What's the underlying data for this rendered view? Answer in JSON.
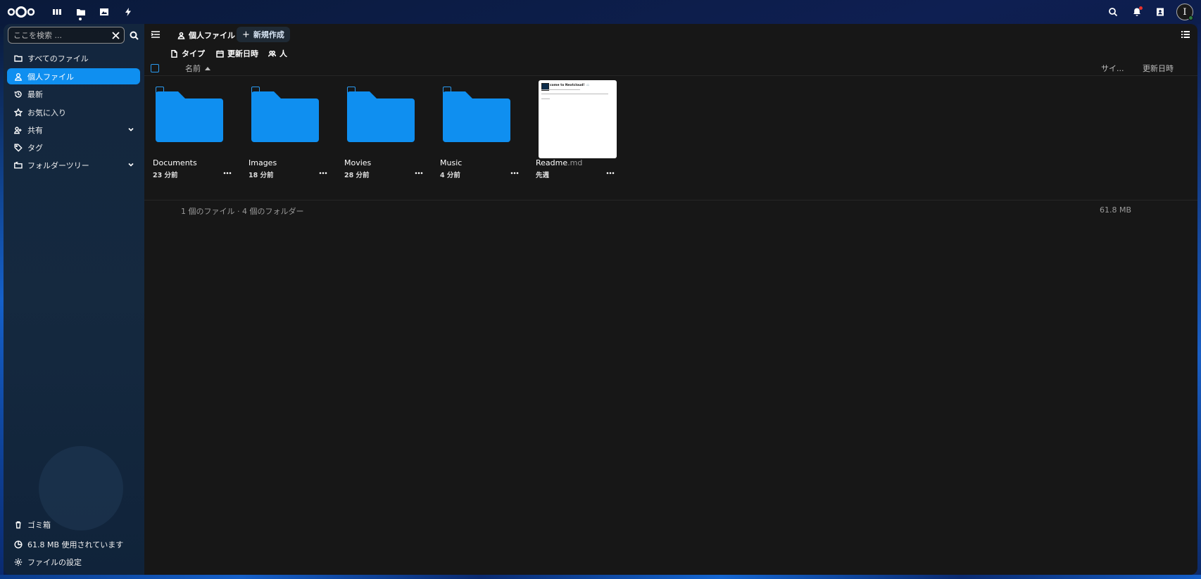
{
  "topbar": {
    "apps": [
      {
        "name": "dashboard",
        "icon": "dashboard-icon"
      },
      {
        "name": "files",
        "icon": "folder-icon",
        "active": true
      },
      {
        "name": "photos",
        "icon": "image-icon"
      },
      {
        "name": "activity",
        "icon": "lightning-icon"
      }
    ],
    "avatar_initial": "I"
  },
  "sidebar": {
    "search_placeholder": "ここを検索 ...",
    "items": [
      {
        "label": "すべてのファイル",
        "icon": "folder-icon"
      },
      {
        "label": "個人ファイル",
        "icon": "user-icon",
        "active": true
      },
      {
        "label": "最新",
        "icon": "history-icon"
      },
      {
        "label": "お気に入り",
        "icon": "star-icon"
      },
      {
        "label": "共有",
        "icon": "share-icon",
        "expandable": true
      },
      {
        "label": "タグ",
        "icon": "tag-icon"
      },
      {
        "label": "フォルダーツリー",
        "icon": "folder-tree-icon",
        "expandable": true
      }
    ],
    "footer": {
      "trash": "ゴミ箱",
      "quota": "61.8 MB 使用されています",
      "settings": "ファイルの設定"
    }
  },
  "main": {
    "breadcrumb": "個人ファイル",
    "new_button": "新規作成",
    "filters": {
      "type": "タイプ",
      "modified": "更新日時",
      "people": "人"
    },
    "columns": {
      "name": "名前",
      "size": "サイ...",
      "modified": "更新日時"
    },
    "files": [
      {
        "name": "Documents",
        "ext": "",
        "time": "23 分前",
        "kind": "folder"
      },
      {
        "name": "Images",
        "ext": "",
        "time": "18 分前",
        "kind": "folder"
      },
      {
        "name": "Movies",
        "ext": "",
        "time": "28 分前",
        "kind": "folder"
      },
      {
        "name": "Music",
        "ext": "",
        "time": "4 分前",
        "kind": "folder"
      },
      {
        "name": "Readme",
        "ext": ".md",
        "time": "先週",
        "kind": "file",
        "preview_title": "come to Nextcloud! ☁️"
      }
    ],
    "summary": {
      "text": "1 個のファイル · 4 個のフォルダー",
      "size": "61.8 MB"
    }
  },
  "colors": {
    "accent": "#0f8ff0",
    "folder": "#0f8ff0",
    "panel": "#171717"
  }
}
